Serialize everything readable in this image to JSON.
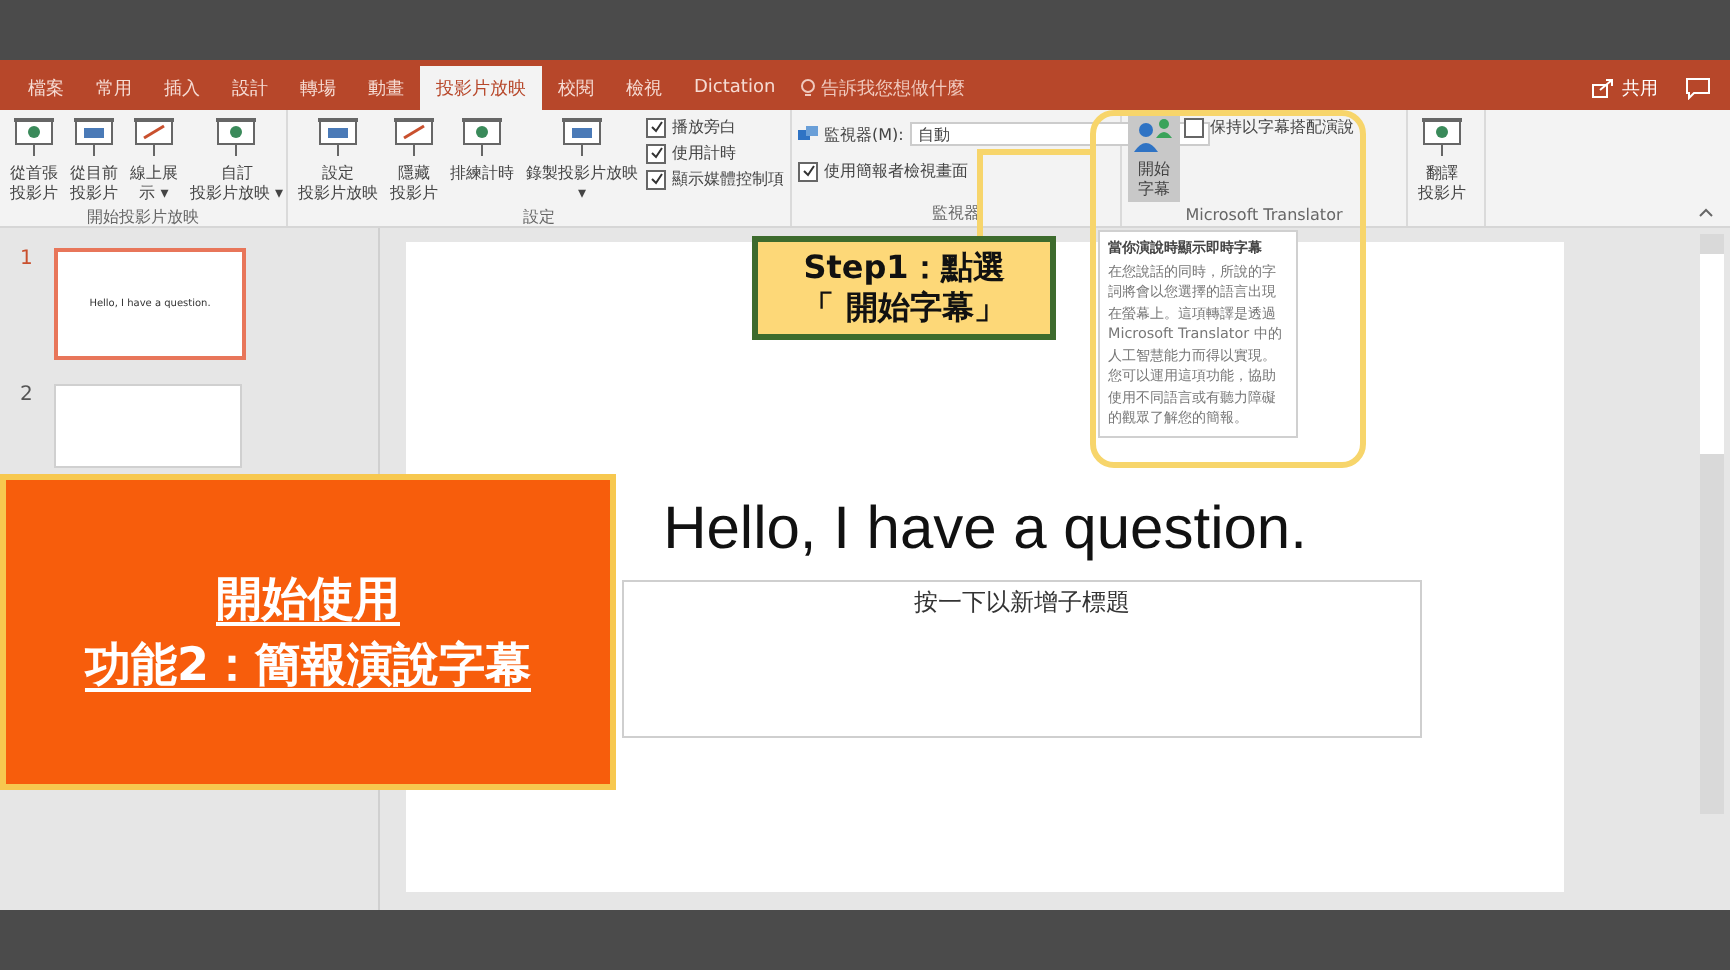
{
  "tabs": [
    {
      "label": "檔案",
      "selected": false
    },
    {
      "label": "常用",
      "selected": false
    },
    {
      "label": "插入",
      "selected": false
    },
    {
      "label": "設計",
      "selected": false
    },
    {
      "label": "轉場",
      "selected": false
    },
    {
      "label": "動畫",
      "selected": false
    },
    {
      "label": "投影片放映",
      "selected": true
    },
    {
      "label": "校閱",
      "selected": false
    },
    {
      "label": "檢視",
      "selected": false
    },
    {
      "label": "Dictation",
      "selected": false
    }
  ],
  "search": {
    "placeholder": "告訴我您想做什麼"
  },
  "share": "共用",
  "ribbon": [
    {
      "label": "開始投影片放映",
      "items": [
        {
          "kind": "button",
          "lines": [
            "從首張",
            "投影片"
          ]
        },
        {
          "kind": "button",
          "lines": [
            "從目前",
            "投影片"
          ]
        },
        {
          "kind": "button",
          "lines": [
            "線上展",
            "示 ▾"
          ]
        },
        {
          "kind": "button",
          "lines": [
            "自訂",
            "投影片放映 ▾"
          ]
        }
      ]
    },
    {
      "label": "設定",
      "items": [
        {
          "kind": "button",
          "lines": [
            "設定",
            "投影片放映"
          ]
        },
        {
          "kind": "button",
          "lines": [
            "隱藏",
            "投影片"
          ]
        },
        {
          "kind": "button",
          "lines": [
            "排練計時"
          ]
        },
        {
          "kind": "button",
          "lines": [
            "錄製投影片放映",
            "▾"
          ]
        },
        {
          "kind": "checks",
          "checks": [
            {
              "label": "播放旁白",
              "checked": true
            },
            {
              "label": "使用計時",
              "checked": true
            },
            {
              "label": "顯示媒體控制項",
              "checked": true
            }
          ]
        }
      ]
    },
    {
      "label": "監視器",
      "items": [
        {
          "kind": "monitor",
          "label": "監視器(M):",
          "value": "自動",
          "checks": [
            {
              "label": "使用簡報者檢視畫面",
              "checked": true
            }
          ]
        }
      ]
    },
    {
      "label": "Microsoft Translator",
      "items": [
        {
          "kind": "button",
          "lines": [
            "開始",
            "字幕"
          ],
          "pressed": true
        },
        {
          "kind": "checks",
          "checks": [
            {
              "label": "保持以字幕搭配演說",
              "checked": false
            }
          ]
        }
      ]
    },
    {
      "items": [
        {
          "kind": "button",
          "lines": [
            "翻譯",
            "投影片"
          ]
        }
      ]
    }
  ],
  "tooltip": {
    "title": "當你演說時顯示即時字幕",
    "body": "在您說話的同時，所說的字詞將會以您選擇的語言出現在螢幕上。這項轉譯是透過 Microsoft Translator 中的人工智慧能力而得以實現。您可以運用這項功能，協助使用不同語言或有聽力障礙的觀眾了解您的簡報。"
  },
  "thumbnails": [
    {
      "number": "1",
      "text": "Hello, I have a question.",
      "selected": true
    },
    {
      "number": "2",
      "selected": false
    }
  ],
  "slide": {
    "title": "Hello, I have a question.",
    "subtitle_placeholder": "按一下以新增子標題"
  },
  "callouts": {
    "feature": [
      "開始使用",
      "功能2：簡報演說字幕"
    ],
    "step": [
      "Step1：點選",
      "「 開始字幕」"
    ]
  }
}
